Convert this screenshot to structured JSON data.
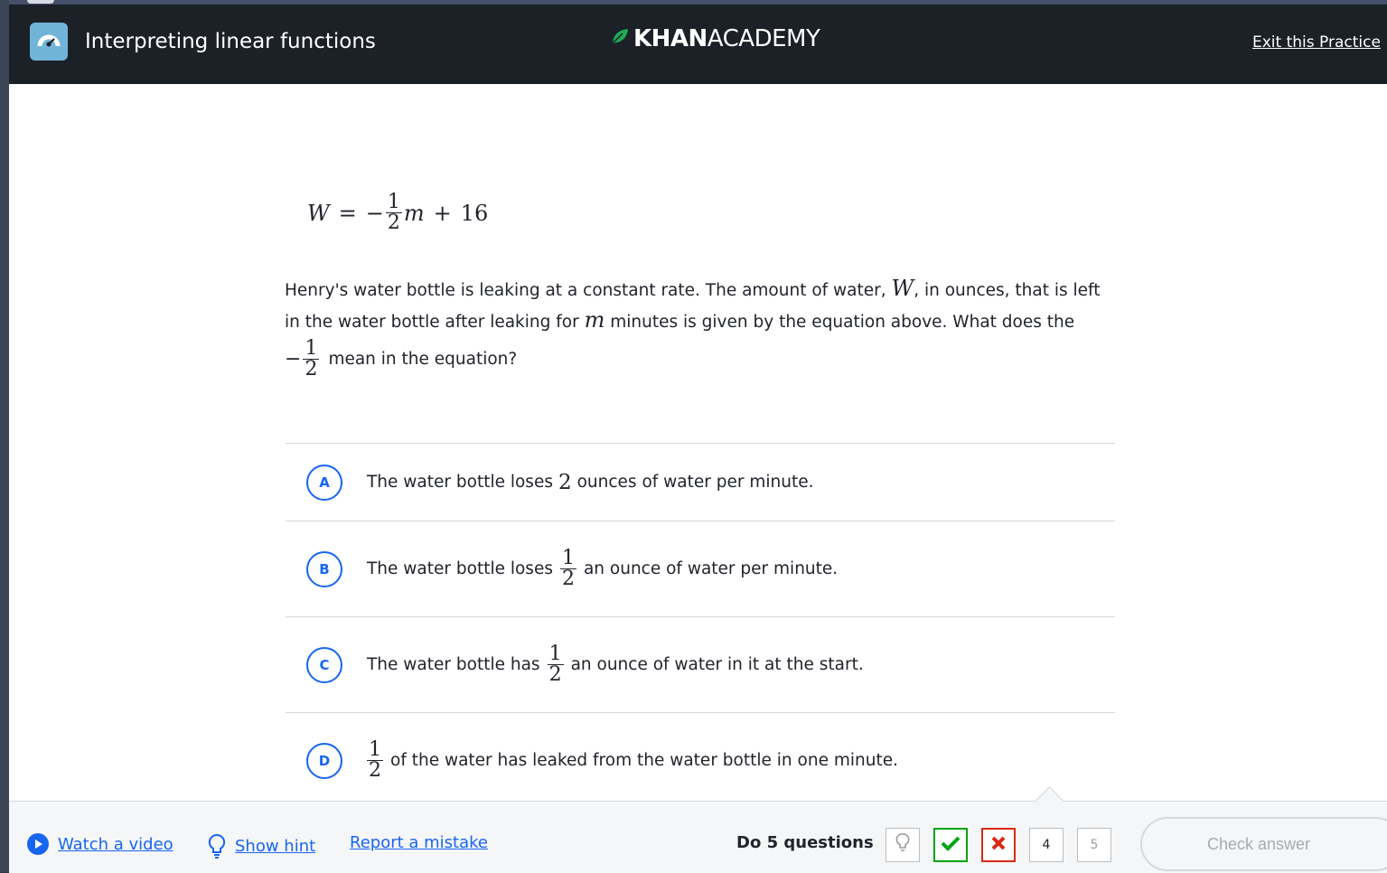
{
  "header": {
    "title": "Interpreting linear functions",
    "logo_bold": "KHAN",
    "logo_light": "ACADEMY",
    "exit_link": "Exit this Practice"
  },
  "equation": {
    "lhs": "W",
    "equals": "=",
    "minus": "−",
    "frac_num": "1",
    "frac_den": "2",
    "var": "m",
    "plus": "+",
    "constant": "16"
  },
  "question": {
    "line1_a": "Henry's water bottle is leaking at a constant rate. The amount of water,",
    "var_w": "W",
    "line1_b": ", in ounces, that is left",
    "line2_a": "in the water bottle after leaking for",
    "var_m": "m",
    "line2_b": "minutes is given by the equation above. What does the",
    "minus": "−",
    "frac_num": "1",
    "frac_den": "2",
    "line3": "mean in the equation?"
  },
  "choices": [
    {
      "letter": "A",
      "text_a": "The water bottle loses",
      "num": "2",
      "text_b": "ounces of water per minute."
    },
    {
      "letter": "B",
      "text_a": "The water bottle loses",
      "frac_num": "1",
      "frac_den": "2",
      "text_b": "an ounce of water per minute."
    },
    {
      "letter": "C",
      "text_a": "The water bottle has",
      "frac_num": "1",
      "frac_den": "2",
      "text_b": "an ounce of water in it at the start."
    },
    {
      "letter": "D",
      "frac_num": "1",
      "frac_den": "2",
      "text_b": "of the water has leaked from the water bottle in one minute."
    }
  ],
  "footer": {
    "watch_video": "Watch a video",
    "show_hint": "Show hint",
    "report_mistake": "Report a mistake",
    "do_questions": "Do 5 questions",
    "progress": [
      {
        "state": "hint",
        "icon": "lightbulb-icon"
      },
      {
        "state": "correct",
        "icon": "check-icon"
      },
      {
        "state": "wrong",
        "icon": "x-icon"
      },
      {
        "state": "current",
        "label": "4"
      },
      {
        "state": "upcoming",
        "label": "5"
      }
    ],
    "check_answer": "Check answer"
  },
  "colors": {
    "topbar": "#1c2027",
    "link_blue": "#1865f2",
    "correct_green": "#00a60e",
    "wrong_red": "#d92916",
    "logo_leaf": "#1fab54",
    "app_icon": "#71b4d9"
  }
}
